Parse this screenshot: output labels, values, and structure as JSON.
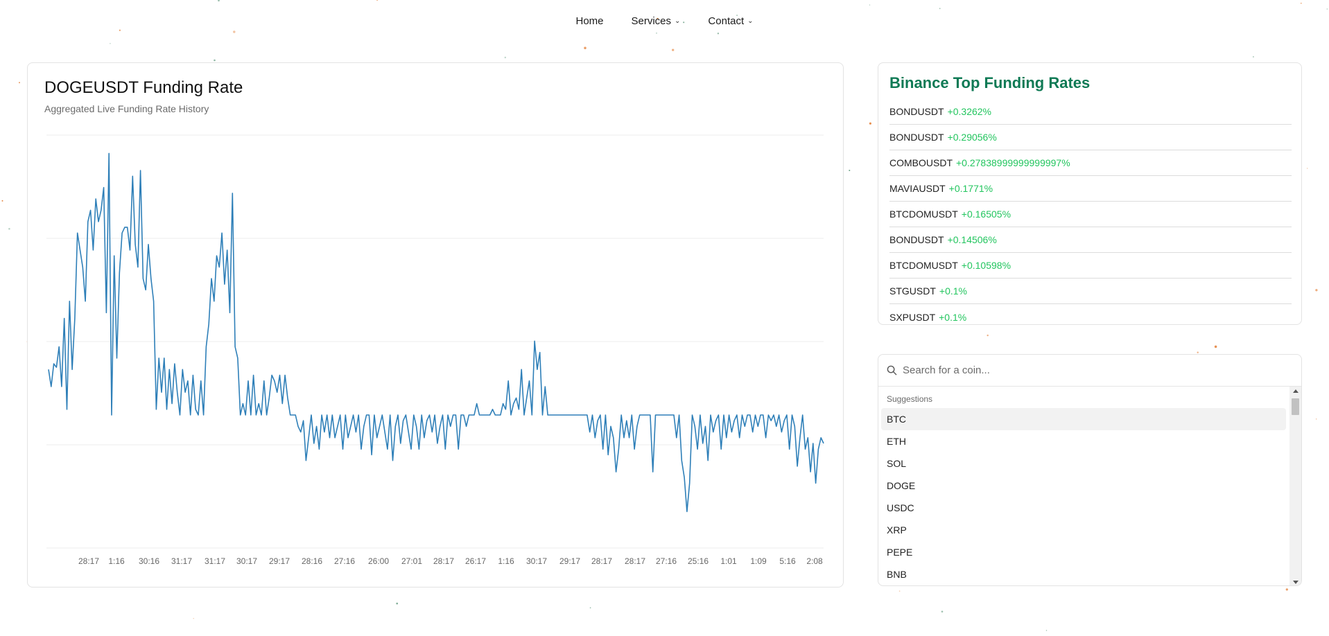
{
  "nav": {
    "items": [
      {
        "label": "Home",
        "dropdown": false
      },
      {
        "label": "Services",
        "dropdown": true
      },
      {
        "label": "Contact",
        "dropdown": true
      }
    ]
  },
  "chart_card": {
    "title": "DOGEUSDT Funding Rate",
    "subtitle": "Aggregated Live Funding Rate History"
  },
  "chart_data": {
    "type": "line",
    "title": "DOGEUSDT Funding Rate",
    "subtitle": "Aggregated Live Funding Rate History",
    "xlabel": "",
    "ylabel": "",
    "grid": true,
    "series_color": "#2e7fb8",
    "x_tick_labels": [
      "28:17",
      "1:16",
      "30:16",
      "31:17",
      "31:17",
      "30:17",
      "29:17",
      "28:16",
      "27:16",
      "26:00",
      "27:01",
      "28:17",
      "26:17",
      "1:16",
      "30:17",
      "29:17",
      "28:17",
      "28:17",
      "27:16",
      "25:16",
      "1:01",
      "1:09",
      "5:16",
      "2:08"
    ],
    "values": [
      0.004,
      0.0025,
      0.0045,
      0.0042,
      0.006,
      0.0025,
      0.0085,
      0.0005,
      0.01,
      0.004,
      0.0085,
      0.016,
      0.0145,
      0.013,
      0.01,
      0.017,
      0.018,
      0.0145,
      0.019,
      0.017,
      0.018,
      0.02,
      0.009,
      0.023,
      0.0,
      0.014,
      0.005,
      0.0125,
      0.016,
      0.0165,
      0.0165,
      0.0145,
      0.021,
      0.015,
      0.013,
      0.0215,
      0.012,
      0.011,
      0.015,
      0.012,
      0.01,
      0.0005,
      0.005,
      0.002,
      0.005,
      0.0005,
      0.004,
      0.001,
      0.0045,
      0.002,
      0.0,
      0.004,
      0.002,
      0.003,
      0.0,
      0.0035,
      0.0005,
      0.0,
      0.003,
      0.0,
      0.006,
      0.008,
      0.012,
      0.01,
      0.014,
      0.013,
      0.016,
      0.0115,
      0.0145,
      0.009,
      0.0195,
      0.006,
      0.005,
      0.0,
      0.001,
      0.0,
      0.003,
      0.0,
      0.0035,
      0.0,
      0.001,
      0.0,
      0.003,
      0.0,
      0.0015,
      0.0035,
      0.003,
      0.002,
      0.0035,
      0.001,
      0.0035,
      0.0015,
      0.0,
      0.0,
      0.0,
      -0.001,
      -0.0015,
      -0.0005,
      -0.004,
      -0.002,
      0.0,
      -0.0025,
      -0.001,
      -0.003,
      0.0,
      -0.0015,
      0.0,
      -0.002,
      0.0,
      -0.002,
      -0.001,
      0.0,
      -0.003,
      0.0,
      -0.002,
      -0.001,
      0.0,
      -0.0015,
      0.0,
      -0.003,
      -0.001,
      0.0,
      0.0,
      -0.0035,
      0.0,
      -0.002,
      -0.001,
      0.0,
      -0.0015,
      -0.003,
      0.0,
      -0.004,
      -0.001,
      0.0,
      -0.0025,
      -0.0005,
      0.0,
      -0.0015,
      -0.003,
      0.0,
      -0.001,
      -0.003,
      0.0,
      -0.002,
      -0.0005,
      0.0,
      -0.0015,
      0.0,
      -0.0025,
      -0.001,
      0.0,
      -0.003,
      0.0,
      -0.001,
      0.0,
      0.0,
      -0.003,
      0.0,
      0.0,
      -0.001,
      0.0,
      0.0,
      0.0,
      0.001,
      0.0,
      0.0,
      0.0,
      0.0,
      0.0,
      0.0005,
      0.0,
      0.0,
      0.0,
      0.001,
      0.0005,
      0.003,
      0.0,
      0.001,
      0.0015,
      0.0005,
      0.004,
      0.0,
      0.0015,
      0.003,
      0.0,
      0.0065,
      0.004,
      0.0055,
      0.0,
      0.0025,
      0.0,
      0.0,
      0.0,
      0.0,
      0.0,
      0.0,
      0.0,
      0.0,
      0.0,
      0.0,
      0.0,
      0.0,
      0.0,
      0.0,
      0.0,
      0.0,
      -0.0015,
      0.0,
      -0.002,
      -0.0005,
      0.0,
      -0.003,
      0.0,
      -0.0035,
      -0.001,
      -0.002,
      -0.005,
      -0.003,
      0.0,
      -0.002,
      -0.0005,
      -0.002,
      0.0,
      -0.003,
      -0.001,
      0.0,
      0.0,
      0.0,
      0.0,
      0.0,
      -0.005,
      0.0,
      0.0,
      0.0,
      0.0,
      0.0,
      0.0,
      0.0,
      0.0,
      -0.002,
      0.0,
      -0.004,
      -0.0055,
      -0.0085,
      -0.006,
      0.0,
      -0.001,
      -0.003,
      0.0,
      -0.0025,
      -0.001,
      -0.004,
      0.0,
      -0.0015,
      -0.0005,
      0.0,
      -0.003,
      0.0,
      -0.002,
      0.0,
      -0.0015,
      -0.0005,
      0.0,
      -0.002,
      0.0,
      -0.001,
      0.0,
      0.0,
      -0.0015,
      0.0,
      -0.001,
      0.0,
      0.0,
      -0.002,
      0.0,
      -0.0005,
      0.0,
      -0.001,
      0.0,
      -0.0015,
      -0.0005,
      0.0,
      -0.003,
      0.0,
      -0.001,
      -0.0045,
      -0.002,
      0.0,
      -0.003,
      -0.002,
      -0.005,
      -0.0025,
      -0.006,
      -0.003,
      -0.002,
      -0.0025
    ]
  },
  "top_rates": {
    "title": "Binance Top Funding Rates",
    "items": [
      {
        "symbol": "BONDUSDT",
        "rate": "+0.3262%"
      },
      {
        "symbol": "BONDUSDT",
        "rate": "+0.29056%"
      },
      {
        "symbol": "COMBOUSDT",
        "rate": "+0.27838999999999997%"
      },
      {
        "symbol": "MAVIAUSDT",
        "rate": "+0.1771%"
      },
      {
        "symbol": "BTCDOMUSDT",
        "rate": "+0.16505%"
      },
      {
        "symbol": "BONDUSDT",
        "rate": "+0.14506%"
      },
      {
        "symbol": "BTCDOMUSDT",
        "rate": "+0.10598%"
      },
      {
        "symbol": "STGUSDT",
        "rate": "+0.1%"
      },
      {
        "symbol": "SXPUSDT",
        "rate": "+0.1%"
      }
    ]
  },
  "search": {
    "placeholder": "Search for a coin...",
    "value": "",
    "suggestions_label": "Suggestions",
    "suggestions": [
      "BTC",
      "ETH",
      "SOL",
      "DOGE",
      "USDC",
      "XRP",
      "PEPE",
      "BNB"
    ],
    "highlighted": "BTC"
  },
  "colors": {
    "accent_green_title": "#0f7a55",
    "rate_positive": "#22c55e",
    "line": "#2e7fb8",
    "dots": "#e0701f"
  }
}
